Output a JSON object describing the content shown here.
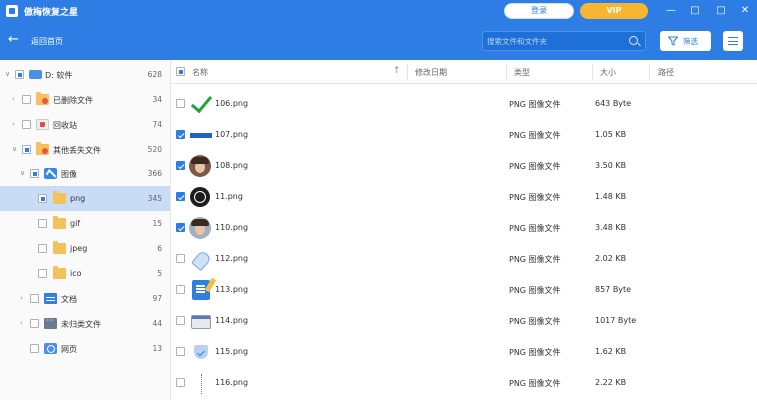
{
  "app": {
    "title": "傲梅恢复之星",
    "login_label": "登录",
    "vip_label": "VIP",
    "accent_color": "#2d7de4"
  },
  "window_controls": {
    "minimize": "—",
    "maximize": "□",
    "close": "✕"
  },
  "toolbar": {
    "back_label": "返回首页",
    "search_placeholder": "搜索文件和文件夹",
    "filter_label": "筛选"
  },
  "sidebar": {
    "items": [
      {
        "label": "D: 软件",
        "count": "628",
        "icon": "drive-icon",
        "state": "partial",
        "expanded": true
      },
      {
        "label": "已删除文件",
        "count": "34",
        "icon": "deleted-folder-icon",
        "state": "unchecked",
        "expanded": false
      },
      {
        "label": "回收站",
        "count": "74",
        "icon": "recycle-bin-icon",
        "state": "unchecked",
        "expanded": false
      },
      {
        "label": "其他丢失文件",
        "count": "520",
        "icon": "lost-files-folder-icon",
        "state": "partial",
        "expanded": true
      },
      {
        "label": "图像",
        "count": "366",
        "icon": "image-icon",
        "state": "partial",
        "expanded": true
      },
      {
        "label": "png",
        "count": "345",
        "icon": "folder-icon",
        "state": "partial",
        "selected": true
      },
      {
        "label": "gif",
        "count": "15",
        "icon": "folder-icon",
        "state": "unchecked"
      },
      {
        "label": "jpeg",
        "count": "6",
        "icon": "folder-icon",
        "state": "unchecked"
      },
      {
        "label": "ico",
        "count": "5",
        "icon": "folder-icon",
        "state": "unchecked"
      },
      {
        "label": "文档",
        "count": "97",
        "icon": "document-icon",
        "state": "unchecked",
        "expanded": false
      },
      {
        "label": "未归类文件",
        "count": "44",
        "icon": "unclassified-icon",
        "state": "unchecked",
        "expanded": false
      },
      {
        "label": "网页",
        "count": "13",
        "icon": "webpage-icon",
        "state": "unchecked"
      }
    ]
  },
  "file_list": {
    "columns": [
      "名称",
      "修改日期",
      "类型",
      "大小",
      "路径"
    ],
    "rows": [
      {
        "name": "106.png",
        "date": "",
        "type": "PNG 图像文件",
        "size": "643 Byte",
        "path": "",
        "checked": false,
        "thumb": "checkmark-thumbnail"
      },
      {
        "name": "107.png",
        "date": "",
        "type": "PNG 图像文件",
        "size": "1.05 KB",
        "path": "",
        "checked": true,
        "thumb": "blue-bar-thumbnail"
      },
      {
        "name": "108.png",
        "date": "",
        "type": "PNG 图像文件",
        "size": "3.50 KB",
        "path": "",
        "checked": true,
        "thumb": "face-thumbnail"
      },
      {
        "name": "11.png",
        "date": "",
        "type": "PNG 图像文件",
        "size": "1.48 KB",
        "path": "",
        "checked": true,
        "thumb": "compass-thumbnail"
      },
      {
        "name": "110.png",
        "date": "",
        "type": "PNG 图像文件",
        "size": "3.48 KB",
        "path": "",
        "checked": true,
        "thumb": "face-thumbnail"
      },
      {
        "name": "112.png",
        "date": "",
        "type": "PNG 图像文件",
        "size": "2.02 KB",
        "path": "",
        "checked": false,
        "thumb": "rocket-thumbnail"
      },
      {
        "name": "113.png",
        "date": "",
        "type": "PNG 图像文件",
        "size": "857 Byte",
        "path": "",
        "checked": false,
        "thumb": "document-thumbnail"
      },
      {
        "name": "114.png",
        "date": "",
        "type": "PNG 图像文件",
        "size": "1017 Byte",
        "path": "",
        "checked": false,
        "thumb": "window-thumbnail"
      },
      {
        "name": "115.png",
        "date": "",
        "type": "PNG 图像文件",
        "size": "1.62 KB",
        "path": "",
        "checked": false,
        "thumb": "shield-thumbnail"
      },
      {
        "name": "116.png",
        "date": "",
        "type": "PNG 图像文件",
        "size": "2.22 KB",
        "path": "",
        "checked": false,
        "thumb": "dotted-line-thumbnail"
      }
    ]
  }
}
